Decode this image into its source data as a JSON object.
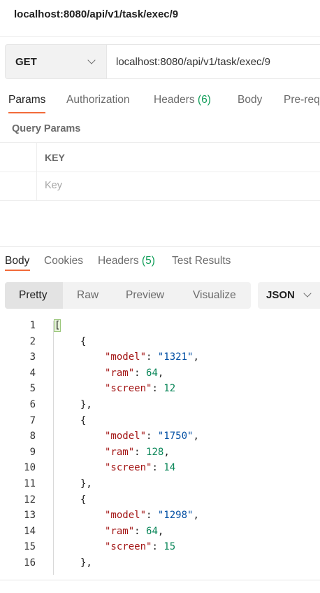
{
  "request": {
    "title": "localhost:8080/api/v1/task/exec/9",
    "method": "GET",
    "url": "localhost:8080/api/v1/task/exec/9"
  },
  "request_tabs": {
    "params": "Params",
    "authorization": "Authorization",
    "headers": "Headers",
    "headers_count": "(6)",
    "body": "Body",
    "prerequest": "Pre-req"
  },
  "query_params": {
    "title": "Query Params",
    "column_key": "KEY",
    "key_placeholder": "Key"
  },
  "response_tabs": {
    "body": "Body",
    "cookies": "Cookies",
    "headers": "Headers",
    "headers_count": "(5)",
    "test_results": "Test Results"
  },
  "view_modes": {
    "pretty": "Pretty",
    "raw": "Raw",
    "preview": "Preview",
    "visualize": "Visualize"
  },
  "format": {
    "selected": "JSON"
  },
  "colors": {
    "accent": "#f26b3a",
    "count_green": "#0f9d58"
  },
  "code": {
    "line_numbers": [
      "1",
      "2",
      "3",
      "4",
      "5",
      "6",
      "7",
      "8",
      "9",
      "10",
      "11",
      "12",
      "13",
      "14",
      "15",
      "16"
    ],
    "open_array": "[",
    "open_brace": "{",
    "close_brace": "},",
    "items": [
      {
        "model": "\"1321\"",
        "ram": "64",
        "screen": "12"
      },
      {
        "model": "\"1750\"",
        "ram": "128",
        "screen": "14"
      },
      {
        "model": "\"1298\"",
        "ram": "64",
        "screen": "15"
      }
    ],
    "key_model": "\"model\"",
    "key_ram": "\"ram\"",
    "key_screen": "\"screen\"",
    "colon": ": ",
    "comma": ","
  }
}
